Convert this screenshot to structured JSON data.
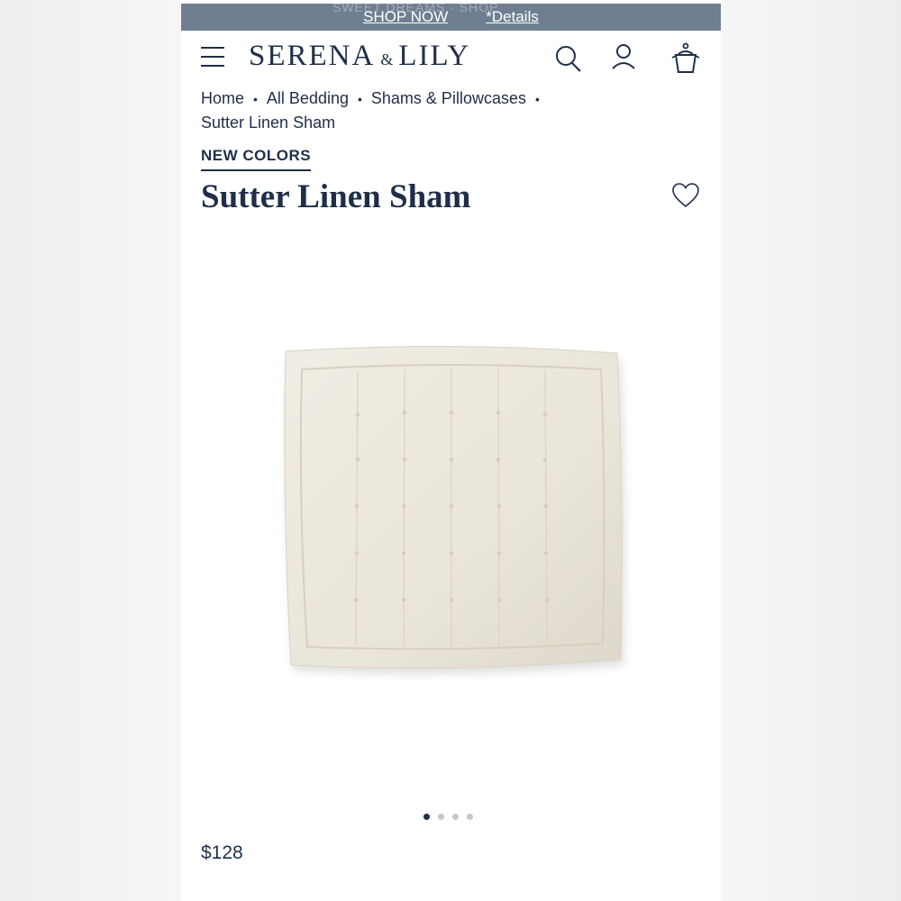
{
  "promo": {
    "faded_text": "SWEET DREAMS · SHOP",
    "shop_now": "SHOP NOW",
    "details": "*Details"
  },
  "header": {
    "logo_left": "SERENA",
    "logo_amp": "&",
    "logo_right": "LILY",
    "icons": [
      "menu-icon",
      "search-icon",
      "account-icon",
      "cart-icon"
    ]
  },
  "breadcrumb": {
    "items": [
      "Home",
      "All Bedding",
      "Shams & Pillowcases",
      "Sutter Linen Sham"
    ]
  },
  "product": {
    "badge": "NEW COLORS",
    "title": "Sutter Linen Sham",
    "price": "$128",
    "image_count": 4,
    "active_image": 1
  },
  "colors": {
    "brand_navy": "#1f2f48",
    "promo_bar": "#6f7f91",
    "pillow": "#ebe7dc"
  }
}
